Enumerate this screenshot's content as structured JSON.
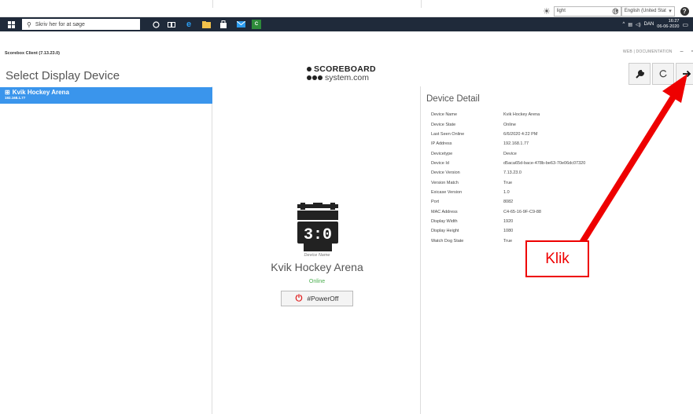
{
  "top_strip": {
    "theme_select": "light",
    "language_select": "English (United Stat"
  },
  "taskbar": {
    "search_placeholder": "Skriv her for at søge",
    "tray_lang": "DAN",
    "time": "16:27",
    "date": "06-06-2020"
  },
  "app": {
    "window_title": "Scorebox Client (7.13.23.0)",
    "docs_link": "WEB | DOCUMENTATION",
    "page_title": "Select Display Device",
    "logo_line1": "SCOREBOARD",
    "logo_line2": "system.com"
  },
  "devices": [
    {
      "name": "Kvik Hockey Arena",
      "ip": "192.168.1.77"
    }
  ],
  "center": {
    "label": "Device Name",
    "name": "Kvik Hockey Arena",
    "state": "Online",
    "power_button": "#PowerOff"
  },
  "detail": {
    "title": "Device Detail",
    "rows": [
      {
        "key": "Device Name",
        "value": "Kvik Hockey Arena"
      },
      {
        "key": "Device State",
        "value": "Online"
      },
      {
        "key": "Last Seen Online",
        "value": "6/6/2020 4:22 PM"
      },
      {
        "key": "IP Address",
        "value": "192.168.1.77"
      },
      {
        "key": "Devicetype",
        "value": "Device"
      },
      {
        "key": "Device Id",
        "value": "d5aca65d-bace-478b-be63-70e06dc07320"
      },
      {
        "key": "Device Version",
        "value": "7.13.23.0"
      },
      {
        "key": "Version Match",
        "value": "True"
      },
      {
        "key": "Exicase Version",
        "value": "1.0"
      },
      {
        "key": "Port",
        "value": "8082"
      },
      {
        "key": "MAC Address",
        "value": "C4-65-16-9F-C9-88"
      },
      {
        "key": "Display Width",
        "value": "1920"
      },
      {
        "key": "Display Height",
        "value": "1080"
      },
      {
        "key": "Watch Dog State",
        "value": "True"
      }
    ]
  },
  "annotation": {
    "text": "Klik",
    "color": "#e00000"
  }
}
